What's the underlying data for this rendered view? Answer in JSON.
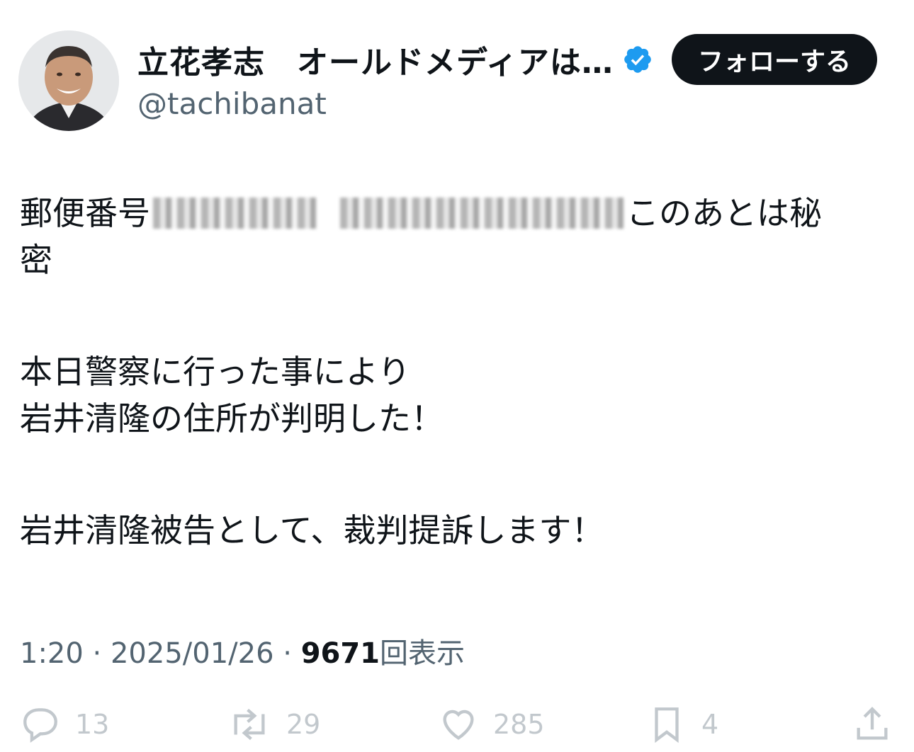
{
  "author": {
    "display_name": "立花孝志　オールドメディアは…",
    "handle": "@tachibanat",
    "verified": true
  },
  "follow_button": {
    "label": "フォローする"
  },
  "tweet": {
    "line1_prefix": "郵便番号",
    "line1_suffix": "このあとは秘",
    "line2": "密",
    "line3": "本日警察に行った事により",
    "line4": "岩井清隆の住所が判明した！",
    "line5": "岩井清隆被告として、裁判提訴します！"
  },
  "meta": {
    "time": "1:20",
    "separator": "·",
    "date": "2025/01/26",
    "views": "9671",
    "views_label": "回表示"
  },
  "actions": {
    "replies": "13",
    "reposts": "29",
    "likes": "285",
    "bookmarks": "4"
  },
  "colors": {
    "text": "#0f1419",
    "secondary": "#536471",
    "verified": "#1d9bf0",
    "follow_bg": "#0f1419"
  }
}
